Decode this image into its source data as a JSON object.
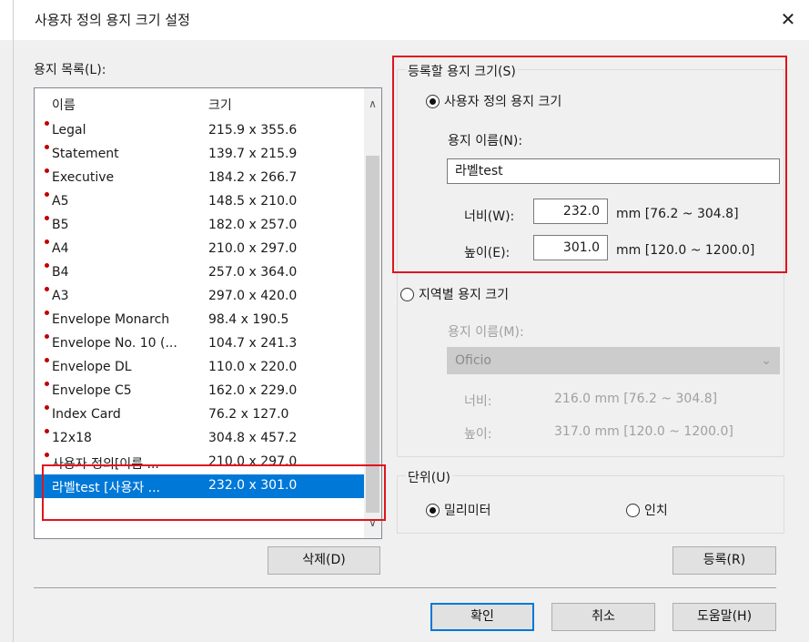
{
  "window": {
    "title": "사용자 정의 용지 크기 설정",
    "close_glyph": "✕"
  },
  "paper_list": {
    "label": "용지 목록(L):",
    "columns": [
      "이름",
      "크기"
    ],
    "rows": [
      {
        "name": "Legal",
        "size": "215.9 x 355.6"
      },
      {
        "name": "Statement",
        "size": "139.7 x 215.9"
      },
      {
        "name": "Executive",
        "size": "184.2 x 266.7"
      },
      {
        "name": "A5",
        "size": "148.5 x 210.0"
      },
      {
        "name": "B5",
        "size": "182.0 x 257.0"
      },
      {
        "name": "A4",
        "size": "210.0 x 297.0"
      },
      {
        "name": "B4",
        "size": "257.0 x 364.0"
      },
      {
        "name": "A3",
        "size": "297.0 x 420.0"
      },
      {
        "name": "Envelope Monarch",
        "size": "98.4 x 190.5"
      },
      {
        "name": "Envelope No. 10 (...",
        "size": "104.7 x 241.3"
      },
      {
        "name": "Envelope DL",
        "size": "110.0 x 220.0"
      },
      {
        "name": "Envelope C5",
        "size": "162.0 x 229.0"
      },
      {
        "name": "Index Card",
        "size": "76.2 x 127.0"
      },
      {
        "name": "12x18",
        "size": "304.8 x 457.2"
      },
      {
        "name": "사용자 정의[이름 ...",
        "size": "210.0 x 297.0"
      },
      {
        "name": "라벨test [사용자 ...",
        "size": "232.0 x 301.0",
        "selected": true
      }
    ]
  },
  "buttons": {
    "delete": "삭제(D)",
    "register": "등록(R)",
    "ok": "확인",
    "cancel": "취소",
    "help": "도움말(H)"
  },
  "register_group": {
    "label": "등록할 용지 크기(S)",
    "custom_radio": "사용자 정의 용지 크기",
    "paper_name_label": "용지 이름(N):",
    "paper_name_value": "라벨test",
    "width_label": "너비(W):",
    "width_value": "232.0",
    "width_range": "mm [76.2 ~ 304.8]",
    "height_label": "높이(E):",
    "height_value": "301.0",
    "height_range": "mm [120.0 ~ 1200.0]",
    "regional_radio": "지역별 용지 크기",
    "regional_name_label": "용지 이름(M):",
    "regional_value": "Oficio",
    "regional_width_label": "너비:",
    "regional_width_value": "216.0 mm [76.2 ~ 304.8]",
    "regional_height_label": "높이:",
    "regional_height_value": "317.0 mm [120.0 ~ 1200.0]"
  },
  "unit_group": {
    "label": "단위(U)",
    "mm": "밀리미터",
    "inch": "인치"
  },
  "colors": {
    "accent": "#0078d7",
    "highlight_box": "#e0141e"
  }
}
